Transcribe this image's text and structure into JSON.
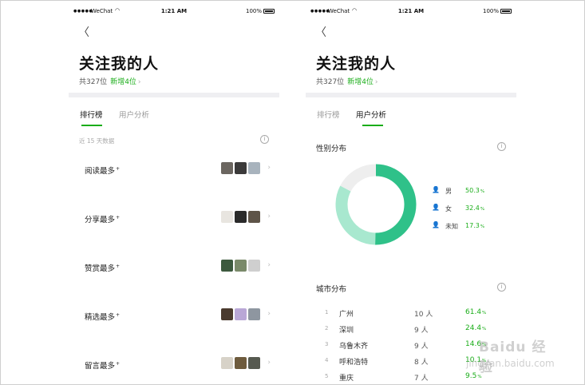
{
  "status_bar": {
    "carrier": "WeChat",
    "time": "1:21 AM",
    "battery": "100%"
  },
  "header": {
    "title": "关注我的人",
    "total": "共327位",
    "new_followers": "新增4位"
  },
  "tabs": [
    {
      "label": "排行榜"
    },
    {
      "label": "用户分析"
    }
  ],
  "ranking": {
    "hint": "近 15 天数据",
    "rows": [
      {
        "label": "阅读最多",
        "sup": "+"
      },
      {
        "label": "分享最多",
        "sup": "+"
      },
      {
        "label": "赞赏最多",
        "sup": "+"
      },
      {
        "label": "精选最多",
        "sup": "+"
      },
      {
        "label": "留言最多",
        "sup": "+"
      }
    ],
    "thumb_colors": [
      [
        "#6b6660",
        "#3b3a3a",
        "#a8b3bd"
      ],
      [
        "#e8e5e0",
        "#2a2a2a",
        "#5e5448"
      ],
      [
        "#3d5a3e",
        "#7a8a6a",
        "#cfcfcf"
      ],
      [
        "#4a3a2e",
        "#b9a7d6",
        "#8e96a0"
      ],
      [
        "#d7d2c8",
        "#6e5b3d",
        "#565a50"
      ]
    ]
  },
  "gender": {
    "title": "性别分布",
    "items": [
      {
        "label": "男",
        "value": "50.3",
        "unit": "%",
        "fraction": 0.503,
        "color": "#2fc189"
      },
      {
        "label": "女",
        "value": "32.4",
        "unit": "%",
        "fraction": 0.324,
        "color": "#a8e8cf"
      },
      {
        "label": "未知",
        "value": "17.3",
        "unit": "%",
        "fraction": 0.173,
        "color": "#eeeeee"
      }
    ]
  },
  "city": {
    "title": "城市分布",
    "items": [
      {
        "rank": "1",
        "name": "广州",
        "count": "10 人",
        "pct": "61.4",
        "unit": "%"
      },
      {
        "rank": "2",
        "name": "深圳",
        "count": "9 人",
        "pct": "24.4",
        "unit": "%"
      },
      {
        "rank": "3",
        "name": "乌鲁木齐",
        "count": "9 人",
        "pct": "14.6",
        "unit": "%"
      },
      {
        "rank": "4",
        "name": "呼和浩特",
        "count": "8 人",
        "pct": "10.1",
        "unit": "%"
      },
      {
        "rank": "5",
        "name": "重庆",
        "count": "7 人",
        "pct": "9.5",
        "unit": "%"
      }
    ]
  },
  "colors": {
    "accent": "#1aad19",
    "donut_male": "#2fc189",
    "donut_female": "#a8e8cf",
    "donut_unknown": "#eeeeee"
  },
  "icons": {
    "back": "chevron-left-icon",
    "info": "info-icon",
    "row": "chevron-right-icon"
  },
  "watermark": {
    "text": "Baidu 经验",
    "sub": "jingyan.baidu.com"
  }
}
